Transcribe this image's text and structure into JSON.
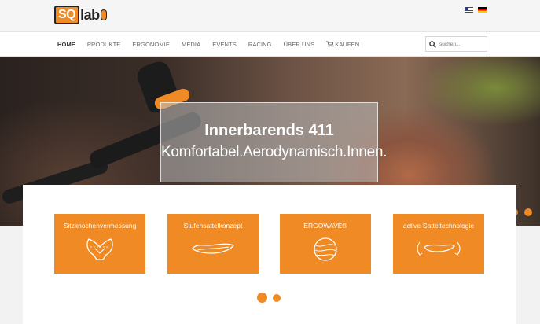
{
  "logo": {
    "sq": "SQ",
    "lab": "lab"
  },
  "languages": [
    {
      "code": "en",
      "name": "english-flag"
    },
    {
      "code": "de",
      "name": "german-flag"
    }
  ],
  "nav": {
    "items": [
      "HOME",
      "PRODUKTE",
      "ERGONOMIE",
      "MEDIA",
      "EVENTS",
      "RACING",
      "ÜBER UNS",
      "KAUFEN"
    ],
    "active": "HOME"
  },
  "search": {
    "placeholder": "suchen..."
  },
  "hero": {
    "title": "Innerbarends 411",
    "subtitle": "Komfortabel.Aerodynamisch.Innen.",
    "slide_count": 2
  },
  "cards": [
    {
      "title": "Sitzknochenvermessung",
      "icon": "pelvis-icon"
    },
    {
      "title": "Stufensattelkonzept",
      "icon": "saddle-icon"
    },
    {
      "title": "ERGOWAVE®",
      "icon": "ergowave-ball-icon"
    },
    {
      "title": "active-Satteltechnologie",
      "icon": "active-saddle-icon"
    }
  ],
  "colors": {
    "accent": "#f08a24",
    "nav_text": "#666666",
    "panel_bg": "#ffffff",
    "page_bg": "#f2f2f2"
  },
  "card_pager": {
    "count": 2,
    "active": 1
  }
}
